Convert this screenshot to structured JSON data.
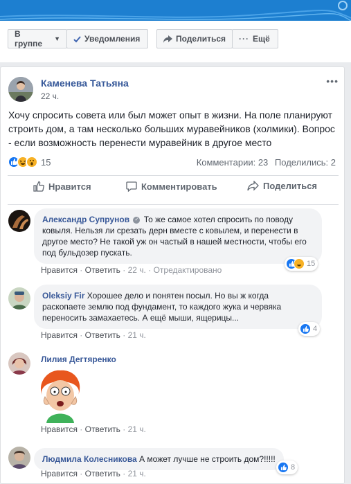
{
  "toolbar": {
    "in_group": "В группе",
    "notifications": "Уведомления",
    "share": "Поделиться",
    "more": "Ещё"
  },
  "post": {
    "author": "Каменева Татьяна",
    "time": "22 ч.",
    "text": "Хочу спросить совета или был может опыт в жизни. На поле планируют строить дом, а там несколько больших муравейников (холмики). Вопрос - если возможность перенести муравейник в другое место",
    "reactions_count": "15",
    "comments_label": "Комментарии: 23",
    "shares_label": "Поделились: 2",
    "actions": {
      "like": "Нравится",
      "comment": "Комментировать",
      "share": "Поделиться"
    }
  },
  "comments": [
    {
      "author": "Александр Супрунов",
      "text": "То же самое хотел спросить по поводу ковыля. Нельзя ли срезать дерн вместе с ковылем, и перенести в другое место? Не такой уж он частый в нашей местности, чтобы его под бульдозер пускать.",
      "like": "Нравится",
      "reply": "Ответить",
      "time": "22 ч.",
      "edited": "Отредактировано",
      "reactions_count": "15"
    },
    {
      "author": "Oleksiy Fir",
      "text": "Хорошее дело и понятен посыл. Но вы ж когда раскопаете землю под фундамент, то каждого жука и червяка переносить замахаетесь. А ещё мыши, ящерицы...",
      "like": "Нравится",
      "reply": "Ответить",
      "time": "21 ч.",
      "reactions_count": "4"
    },
    {
      "author": "Лилия Дегтяренко",
      "like": "Нравится",
      "reply": "Ответить",
      "time": "21 ч."
    },
    {
      "author": "Людмила Колесникова",
      "text": "А может лучше не строить дом?!!!!!",
      "like": "Нравится",
      "reply": "Ответить",
      "time": "21 ч.",
      "reactions_count": "8"
    }
  ],
  "sep": "·",
  "colors": {
    "brand": "#365899",
    "like_blue": "#1877f2",
    "haha_yellow": "#f7b125"
  }
}
